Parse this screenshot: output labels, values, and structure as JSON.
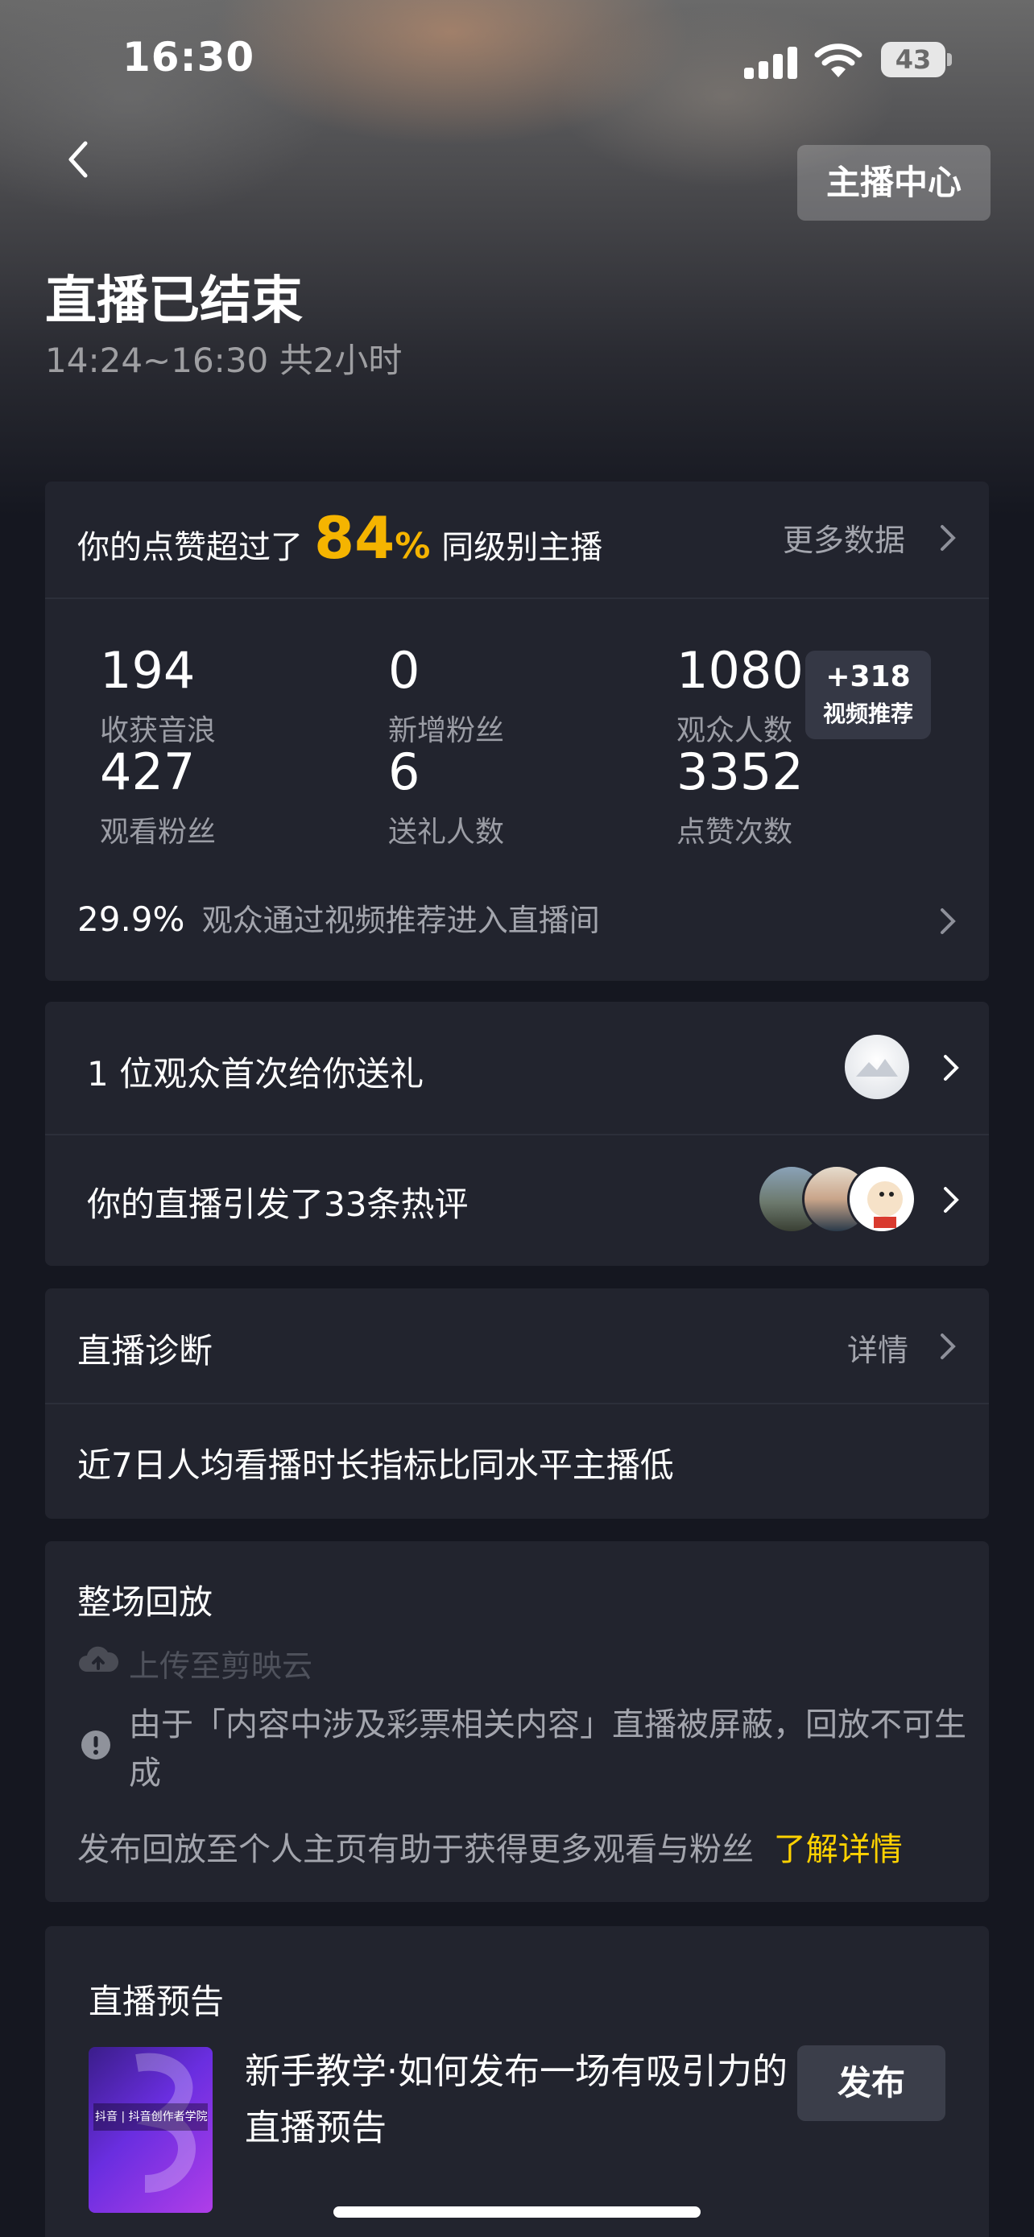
{
  "status_bar": {
    "time": "16:30",
    "battery": "43"
  },
  "header": {
    "host_center_label": "主播中心",
    "title": "直播已结束",
    "subtitle": "14:24~16:30 共2小时"
  },
  "summary": {
    "prefix": "你的点赞超过了",
    "percent": "84",
    "percent_sign": "%",
    "suffix": "同级别主播",
    "more_label": "更多数据",
    "stats": [
      {
        "value": "194",
        "label": "收获音浪"
      },
      {
        "value": "0",
        "label": "新增粉丝"
      },
      {
        "value": "1080",
        "label": "观众人数"
      },
      {
        "value": "427",
        "label": "观看粉丝"
      },
      {
        "value": "6",
        "label": "送礼人数"
      },
      {
        "value": "3352",
        "label": "点赞次数"
      }
    ],
    "badge": {
      "value": "+318",
      "label": "视频推荐"
    },
    "recommend_percent": "29.9%",
    "recommend_text": "观众通过视频推荐进入直播间"
  },
  "interactions": {
    "gift_text": "1 位观众首次给你送礼",
    "comments_text": "你的直播引发了33条热评"
  },
  "diagnosis": {
    "title": "直播诊断",
    "detail_label": "详情",
    "message": "近7日人均看播时长指标比同水平主播低"
  },
  "replay": {
    "title": "整场回放",
    "upload_label": "上传至剪映云",
    "warning_text": "由于「内容中涉及彩票相关内容」直播被屏蔽，回放不可生成",
    "tip_text": "发布回放至个人主页有助于获得更多观看与粉丝",
    "learn_more": "了解详情"
  },
  "preview": {
    "title": "直播预告",
    "thumb_text": "抖音 | 抖音创作者学院",
    "description": "新手教学·如何发布一场有吸引力的直播预告",
    "publish_label": "发布"
  },
  "colors": {
    "accent": "#f5b400",
    "link": "#ffd200",
    "card": "#22242e",
    "background": "#151720"
  }
}
